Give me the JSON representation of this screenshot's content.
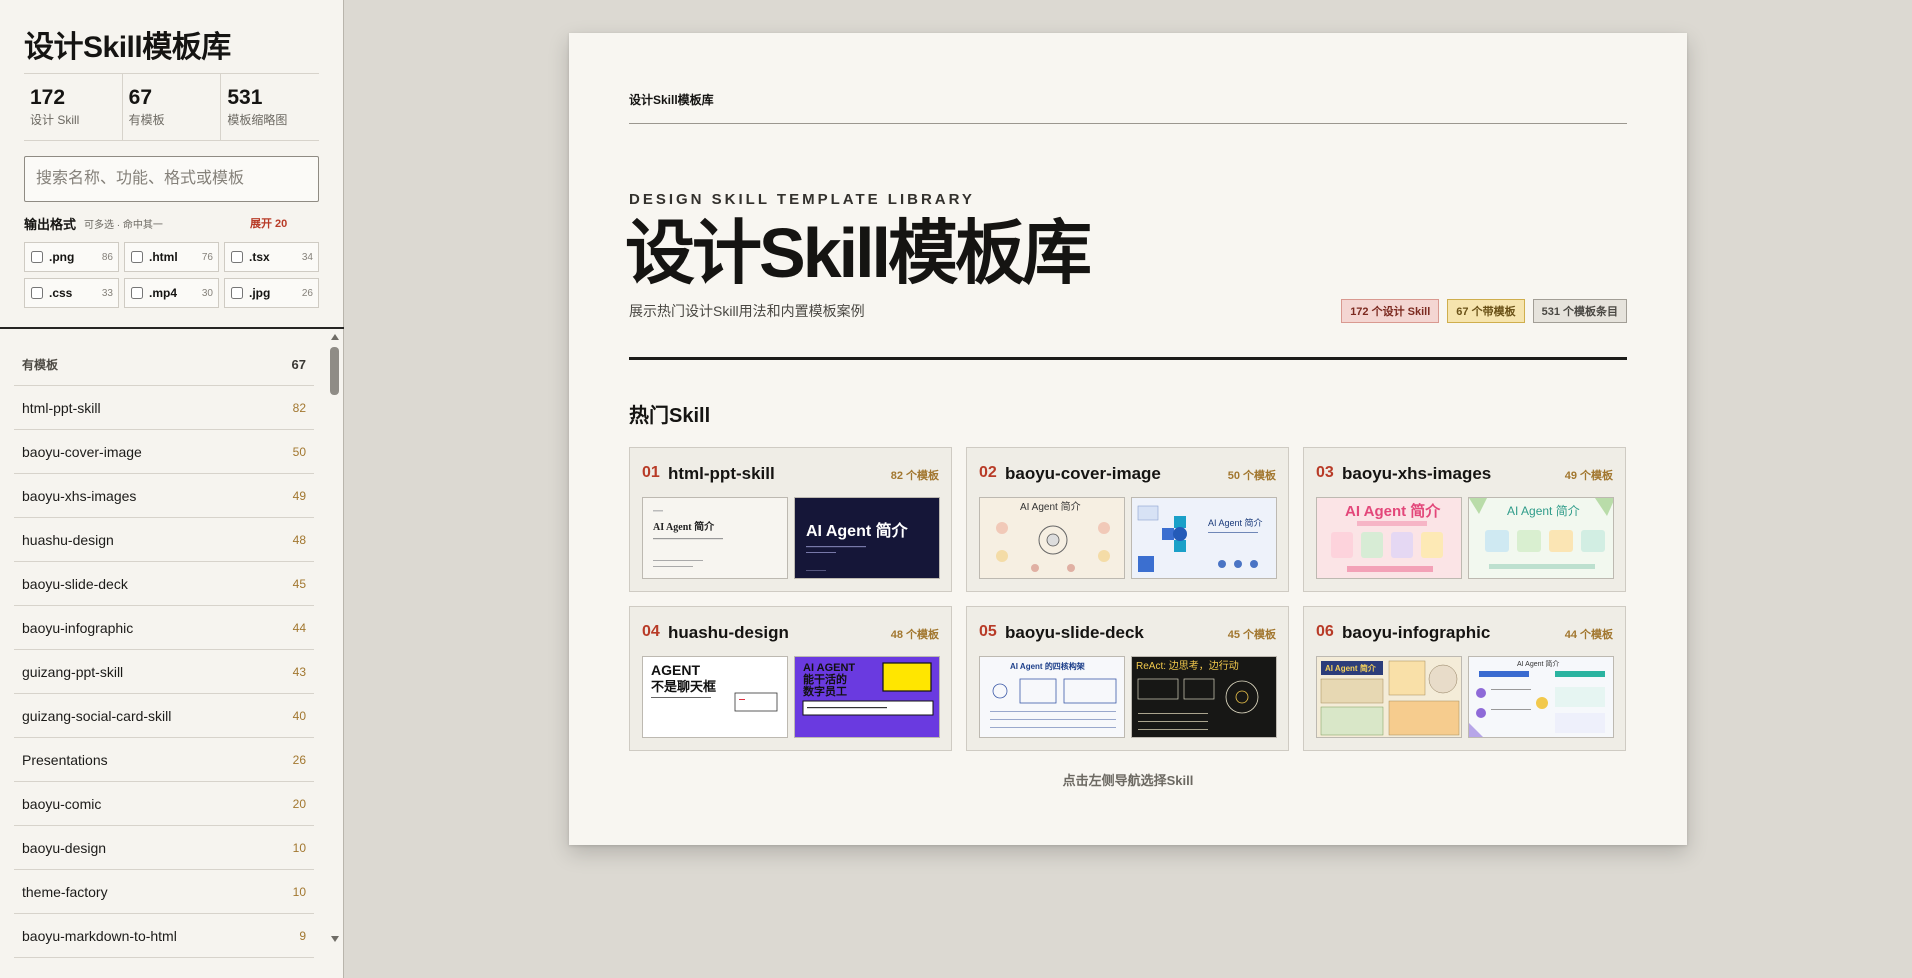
{
  "sidebar": {
    "title": "设计Skill模板库",
    "stats": [
      {
        "value": "172",
        "label": "设计 Skill"
      },
      {
        "value": "67",
        "label": "有模板"
      },
      {
        "value": "531",
        "label": "模板缩略图"
      }
    ],
    "search": {
      "placeholder": "搜索名称、功能、格式或模板",
      "value": ""
    },
    "formats": {
      "title": "输出格式",
      "hint": "可多选 · 命中其一",
      "expand": "展开 20",
      "items": [
        {
          "ext": ".png",
          "count": "86"
        },
        {
          "ext": ".html",
          "count": "76"
        },
        {
          "ext": ".tsx",
          "count": "34"
        },
        {
          "ext": ".css",
          "count": "33"
        },
        {
          "ext": ".mp4",
          "count": "30"
        },
        {
          "ext": ".jpg",
          "count": "26"
        }
      ]
    },
    "list": {
      "header": {
        "label": "有模板",
        "count": "67"
      },
      "items": [
        {
          "name": "html-ppt-skill",
          "count": "82"
        },
        {
          "name": "baoyu-cover-image",
          "count": "50"
        },
        {
          "name": "baoyu-xhs-images",
          "count": "49"
        },
        {
          "name": "huashu-design",
          "count": "48"
        },
        {
          "name": "baoyu-slide-deck",
          "count": "45"
        },
        {
          "name": "baoyu-infographic",
          "count": "44"
        },
        {
          "name": "guizang-ppt-skill",
          "count": "43"
        },
        {
          "name": "guizang-social-card-skill",
          "count": "40"
        },
        {
          "name": "Presentations",
          "count": "26"
        },
        {
          "name": "baoyu-comic",
          "count": "20"
        },
        {
          "name": "baoyu-design",
          "count": "10"
        },
        {
          "name": "theme-factory",
          "count": "10"
        },
        {
          "name": "baoyu-markdown-to-html",
          "count": "9"
        }
      ]
    }
  },
  "main": {
    "top_title": "设计Skill模板库",
    "eyebrow": "DESIGN SKILL TEMPLATE LIBRARY",
    "title": "设计Skill模板库",
    "subtitle": "展示热门设计Skill用法和内置模板案例",
    "badges": [
      "172 个设计 Skill",
      "67 个带模板",
      "531 个模板条目"
    ],
    "section_title": "热门Skill",
    "skills": [
      {
        "index": "01",
        "name": "html-ppt-skill",
        "count": "82 个模板"
      },
      {
        "index": "02",
        "name": "baoyu-cover-image",
        "count": "50 个模板"
      },
      {
        "index": "03",
        "name": "baoyu-xhs-images",
        "count": "49 个模板"
      },
      {
        "index": "04",
        "name": "huashu-design",
        "count": "48 个模板"
      },
      {
        "index": "05",
        "name": "baoyu-slide-deck",
        "count": "45 个模板"
      },
      {
        "index": "06",
        "name": "baoyu-infographic",
        "count": "44 个模板"
      }
    ],
    "thumb_text": {
      "t1a": "AI Agent 简介",
      "t1b": "AI Agent 简介",
      "t2a": "AI Agent 简介",
      "t2b": "AI Agent 简介",
      "t3a": "AI Agent 简介",
      "t3b": "AI Agent 简介",
      "t4a_1": "AGENT",
      "t4a_2": "不是聊天框",
      "t4b_1": "AI AGENT",
      "t4b_2": "能干活的",
      "t4b_3": "数字员工",
      "t5a": "AI Agent 的四核构架",
      "t5b": "ReAct: 边思考，边行动",
      "t6a": "AI Agent 简介",
      "t6b": "AI Agent 简介"
    },
    "footer_hint": "点击左侧导航选择Skill"
  },
  "colors": {
    "accent_red": "#b83b27",
    "count_gold": "#a2772f",
    "page_bg": "#dcd9d2",
    "card_bg": "#f8f6f1"
  }
}
